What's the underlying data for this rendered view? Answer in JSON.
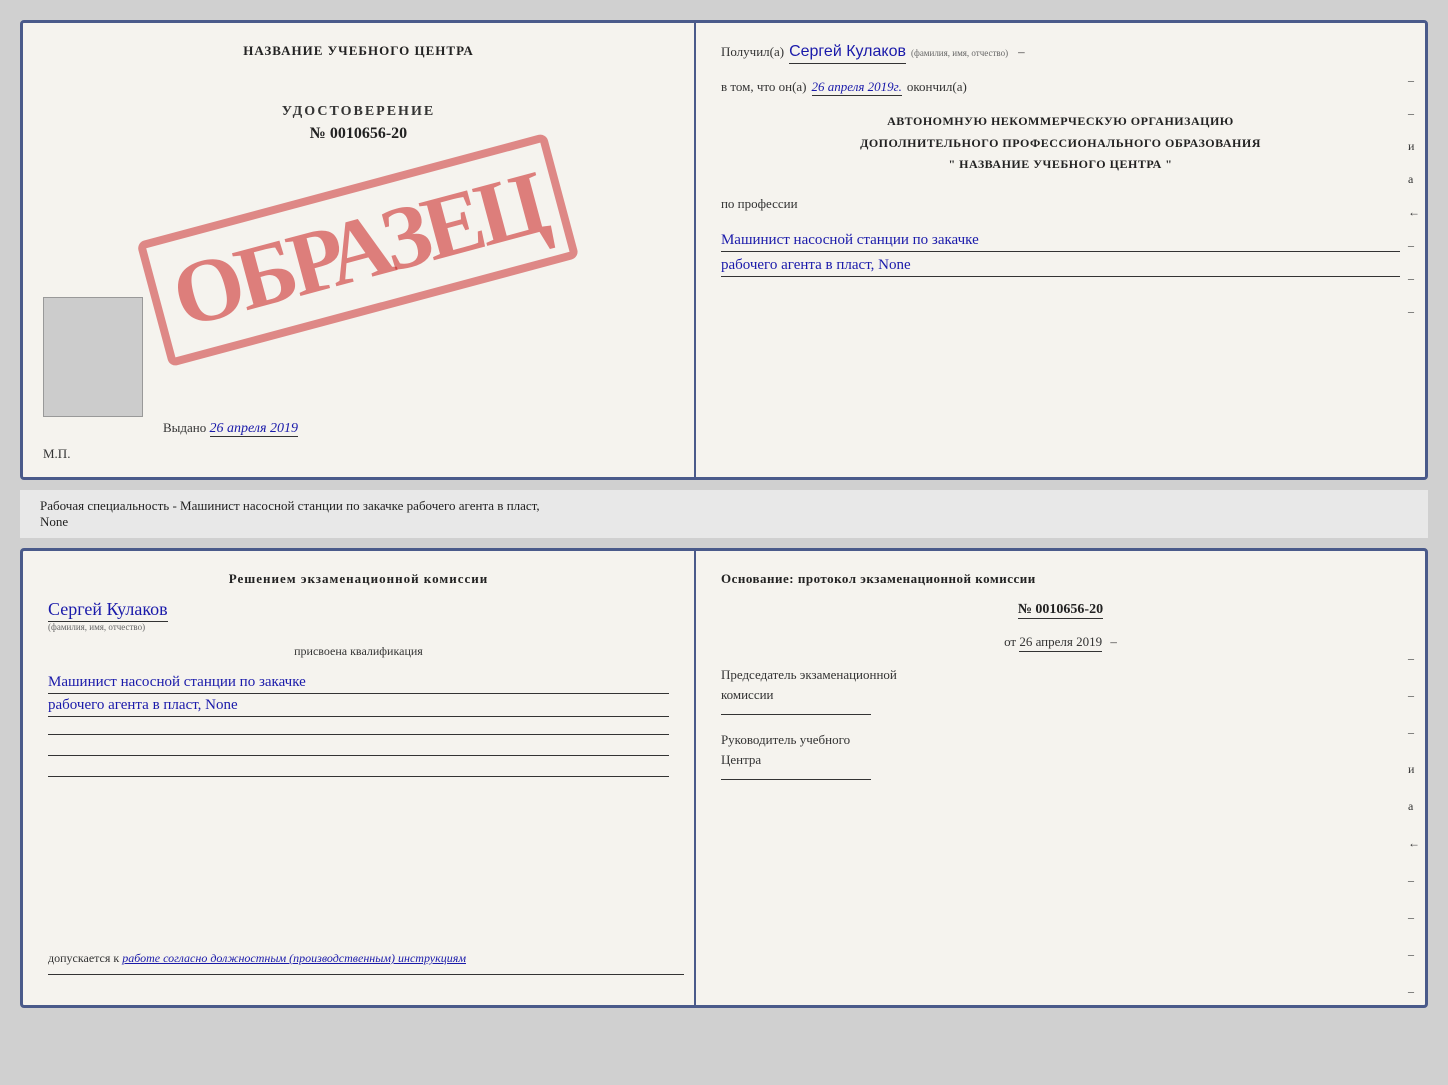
{
  "document1": {
    "left": {
      "center_title": "НАЗВАНИЕ УЧЕБНОГО ЦЕНТРА",
      "stamp_text": "ОБРАЗЕЦ",
      "udostoverenie_label": "УДОСТОВЕРЕНИЕ",
      "udostoverenie_num": "№ 0010656-20",
      "vydano_label": "Выдано",
      "vydano_date": "26 апреля 2019",
      "mp_label": "М.П."
    },
    "right": {
      "poluchil_label": "Получил(а)",
      "poluchil_name": "Сергей Кулаков",
      "familiya_label": "(фамилия, имя, отчество)",
      "dash1": "–",
      "vtom_label": "в том, что он(а)",
      "vtom_date": "26 апреля 2019г.",
      "okonchil_label": "окончил(а)",
      "org_line1": "АВТОНОМНУЮ НЕКОММЕРЧЕСКУЮ ОРГАНИЗАЦИЮ",
      "org_line2": "ДОПОЛНИТЕЛЬНОГО ПРОФЕССИОНАЛЬНОГО ОБРАЗОВАНИЯ",
      "org_name": "\"  НАЗВАНИЕ УЧЕБНОГО ЦЕНТРА  \"",
      "po_professii": "по профессии",
      "prof_line1": "Машинист насосной станции по закачке",
      "prof_line2": "рабочего агента в пласт, None",
      "dashes": [
        "–",
        "–",
        "–",
        "–",
        "–"
      ],
      "и_label": "и",
      "а_label": "а",
      "arrow": "←"
    }
  },
  "divider": {
    "text": "Рабочая специальность - Машинист насосной станции по закачке рабочего агента в пласт,",
    "text2": "None"
  },
  "document2": {
    "left": {
      "resheniem_title": "Решением экзаменационной комиссии",
      "person_name": "Сергей Кулаков",
      "familiya_label": "(фамилия, имя, отчество)",
      "prisvoena": "присвоена квалификация",
      "kval_line1": "Машинист насосной станции по закачке",
      "kval_line2": "рабочего агента в пласт, None",
      "line1": "____________________________",
      "line2": "____________________________",
      "line3": "____________________________",
      "dopuskaetsya": "допускается к",
      "dopusk_underline": "работе согласно должностным (производственным) инструкциям",
      "line4": "____________________________"
    },
    "right": {
      "osnovanie_title": "Основание: протокол экзаменационной комиссии",
      "protocol_num": "№ 0010656-20",
      "ot_label": "от",
      "ot_date": "26 апреля 2019",
      "predsedatel_label": "Председатель экзаменационной",
      "komissii_label": "комиссии",
      "rukovoditel_label": "Руководитель учебного",
      "centra_label": "Центра",
      "dashes": [
        "–",
        "–",
        "–",
        "–",
        "–",
        "–"
      ],
      "и_label": "и",
      "а_label": "а",
      "arrow": "←"
    }
  }
}
